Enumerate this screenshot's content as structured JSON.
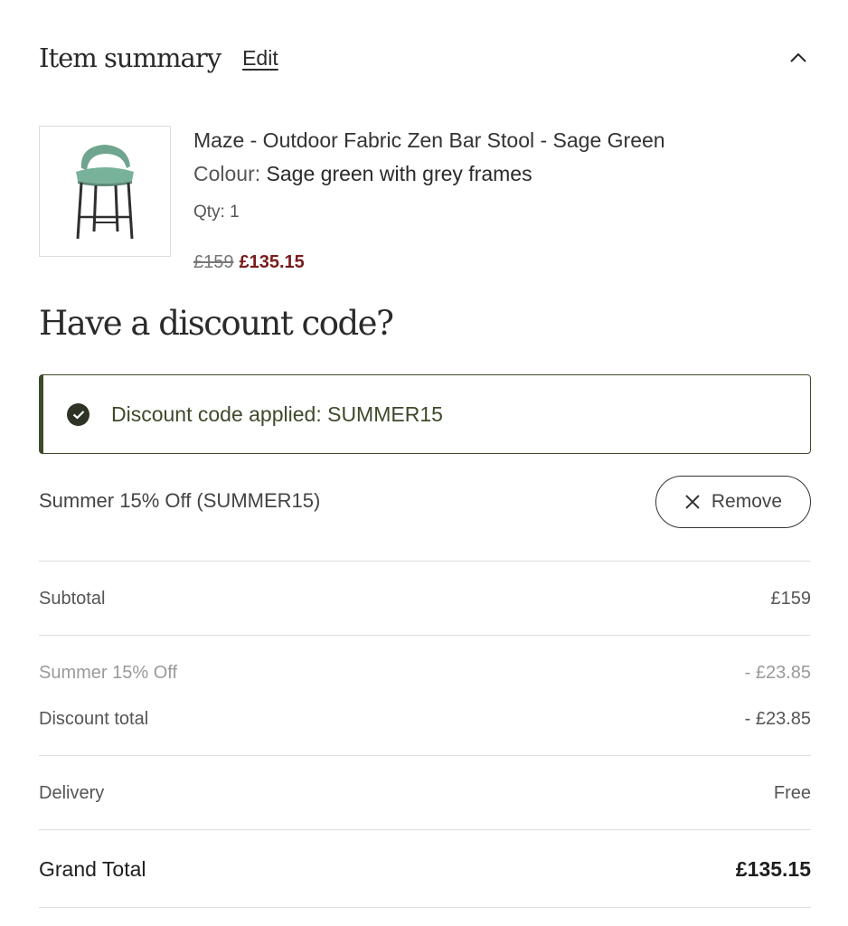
{
  "header": {
    "title": "Item summary",
    "edit_label": "Edit"
  },
  "item": {
    "name": "Maze - Outdoor Fabric Zen Bar Stool - Sage Green",
    "colour_label": "Colour:",
    "colour_value": "Sage green with grey frames",
    "qty": "Qty: 1",
    "price_original": "£159",
    "price_sale": "£135.15"
  },
  "discount": {
    "heading": "Have a discount code?",
    "applied_message": "Discount code applied: SUMMER15",
    "code_name": "Summer 15% Off (SUMMER15)",
    "remove_label": "Remove"
  },
  "summary": {
    "subtotal_label": "Subtotal",
    "subtotal_value": "£159",
    "promo_label": "Summer 15% Off",
    "promo_value": "- £23.85",
    "discount_total_label": "Discount total",
    "discount_total_value": "- £23.85",
    "delivery_label": "Delivery",
    "delivery_value": "Free",
    "grand_total_label": "Grand Total",
    "grand_total_value": "£135.15"
  },
  "colors": {
    "sale_price": "#7a1c1c",
    "success_border": "#3e4a2b",
    "success_text": "#3d4a2a",
    "product_seat": "#6fa58e"
  },
  "icons": {
    "collapse": "chevron-up-icon",
    "check": "check-circle-icon",
    "remove": "close-icon"
  }
}
